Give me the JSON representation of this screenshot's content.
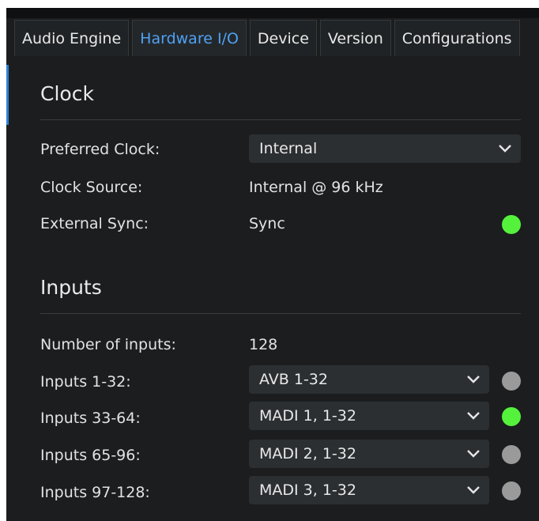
{
  "tabs": [
    {
      "label": "Audio Engine",
      "active": false
    },
    {
      "label": "Hardware I/O",
      "active": true
    },
    {
      "label": "Device",
      "active": false
    },
    {
      "label": "Version",
      "active": false
    },
    {
      "label": "Configurations",
      "active": false
    }
  ],
  "colors": {
    "accent": "#4ea2f5",
    "status_ok": "#55f23c",
    "status_off": "#9a9a9a"
  },
  "clock": {
    "title": "Clock",
    "preferred_label": "Preferred Clock:",
    "preferred_value": "Internal",
    "source_label": "Clock Source:",
    "source_value": "Internal @ 96 kHz",
    "sync_label": "External Sync:",
    "sync_value": "Sync",
    "sync_status": "green-status-dot"
  },
  "inputs": {
    "title": "Inputs",
    "count_label": "Number of inputs:",
    "count_value": "128",
    "rows": [
      {
        "label": "Inputs 1-32:",
        "value": "AVB 1-32",
        "status": "gray-status-dot"
      },
      {
        "label": "Inputs 33-64:",
        "value": "MADI 1, 1-32",
        "status": "green-status-dot"
      },
      {
        "label": "Inputs 65-96:",
        "value": "MADI 2, 1-32",
        "status": "gray-status-dot"
      },
      {
        "label": "Inputs 97-128:",
        "value": "MADI 3, 1-32",
        "status": "gray-status-dot"
      }
    ]
  }
}
